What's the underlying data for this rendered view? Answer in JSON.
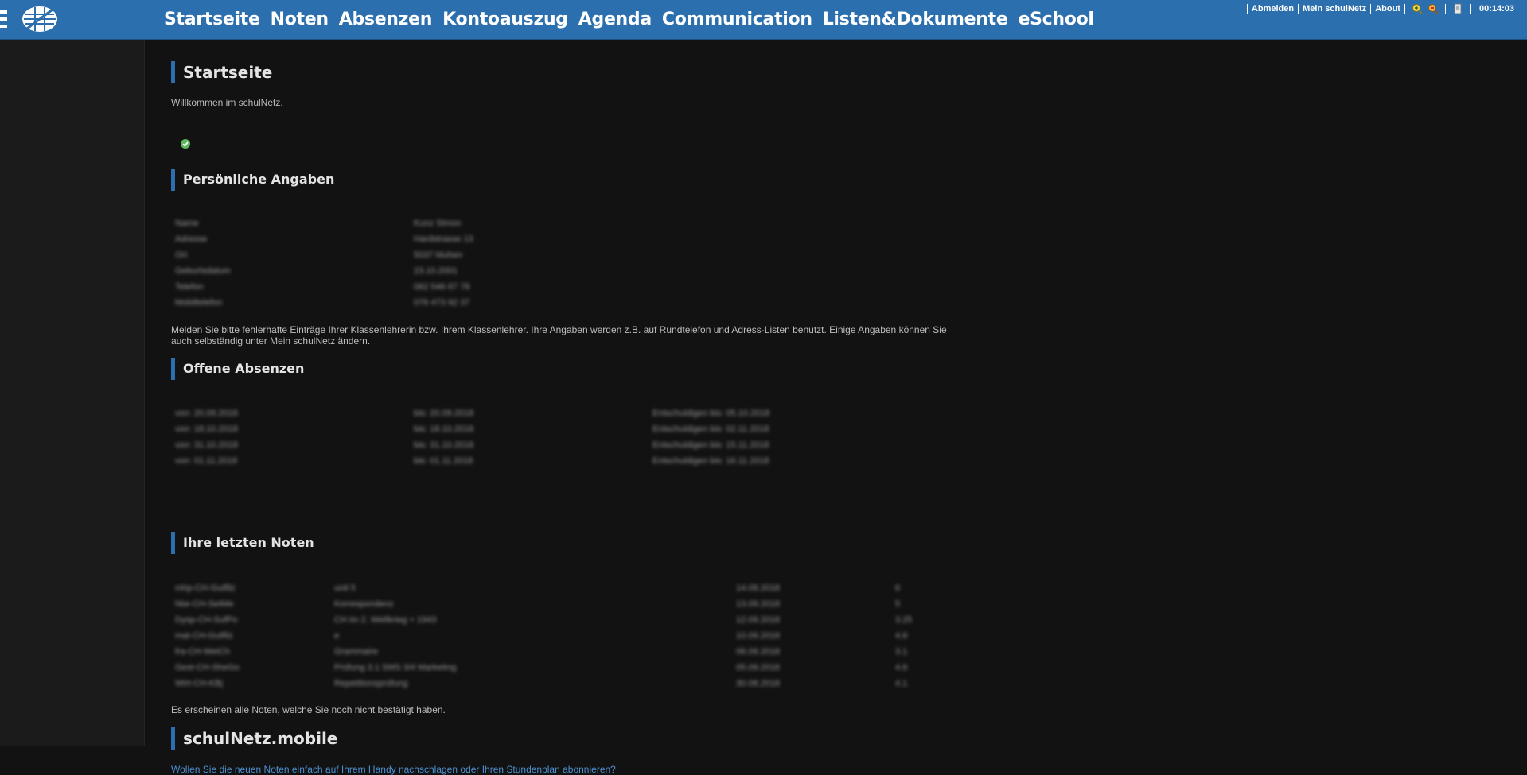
{
  "nav": {
    "items": [
      "Startseite",
      "Noten",
      "Absenzen",
      "Kontoauszug",
      "Agenda",
      "Communication",
      "Listen&Dokumente",
      "eSchool"
    ]
  },
  "utility": {
    "logout": "Abmelden",
    "my_account": "Mein schulNetz",
    "about": "About",
    "time": "00:14:03"
  },
  "page": {
    "title": "Startseite",
    "welcome": "Willkommen im schulNetz."
  },
  "personal": {
    "title": "Persönliche Angaben",
    "rows": [
      [
        "Name",
        "Kunz Simon"
      ],
      [
        "Adresse",
        "Hardstrasse 13"
      ],
      [
        "Ort",
        "5037 Muhen"
      ],
      [
        "Geburtsdatum",
        "23.10.2001"
      ],
      [
        "Telefon",
        "062 546 67 78"
      ],
      [
        "Mobiltelefon",
        "076 473 92 37"
      ]
    ],
    "note": "Melden Sie bitte fehlerhafte Einträge Ihrer Klassenlehrerin bzw. Ihrem Klassenlehrer. Ihre Angaben werden z.B. auf Rundtelefon und Adress-Listen benutzt. Einige Angaben können Sie auch selbständig unter Mein schulNetz ändern."
  },
  "absences": {
    "title": "Offene Absenzen",
    "rows": [
      [
        "von: 20.09.2018",
        "bis: 20.09.2018",
        "Entschuldigen bis: 05.10.2018"
      ],
      [
        "von: 18.10.2018",
        "bis: 18.10.2018",
        "Entschuldigen bis: 02.11.2018"
      ],
      [
        "von: 31.10.2018",
        "bis: 31.10.2018",
        "Entschuldigen bis: 15.11.2018"
      ],
      [
        "von: 01.11.2018",
        "bis: 01.11.2018",
        "Entschuldigen bis: 16.11.2018"
      ]
    ]
  },
  "grades": {
    "title": "Ihre letzten Noten",
    "rows": [
      [
        "mhp-CH-Gutfilz",
        "unit 5",
        "14.09.2018",
        "6"
      ],
      [
        "hbe-CH-SetMe",
        "Korrespondenz",
        "13.09.2018",
        "5"
      ],
      [
        "Dysp-CH-SufPo",
        "CH im 2. Weltkrieg + 1943",
        "12.09.2018",
        "3.25"
      ],
      [
        "mat-CH-Gutfilz",
        "e",
        "10.09.2018",
        "4.6"
      ],
      [
        "fra-CH-WeiCh",
        "Grammaire",
        "06.09.2018",
        "3.1"
      ],
      [
        "Gest-CH-SheGo",
        "Prüfung 3.1 SMS 3/4 Marketing",
        "05.09.2018",
        "4.6"
      ],
      [
        "Wirt-CH-KBj",
        "Repetitionsprüfung",
        "30.08.2018",
        "4.1"
      ]
    ],
    "note": "Es erscheinen alle Noten, welche Sie noch nicht bestätigt haben."
  },
  "mobile": {
    "title": "schulNetz.mobile",
    "link": "Wollen Sie die neuen Noten einfach auf Ihrem Handy nachschlagen oder Ihren Stundenplan abonnieren?"
  },
  "colors": {
    "header": "#2c6fae",
    "background": "#121212",
    "accent": "#2c6fae",
    "link": "#4f8fd1",
    "ok": "#5cb85c"
  }
}
